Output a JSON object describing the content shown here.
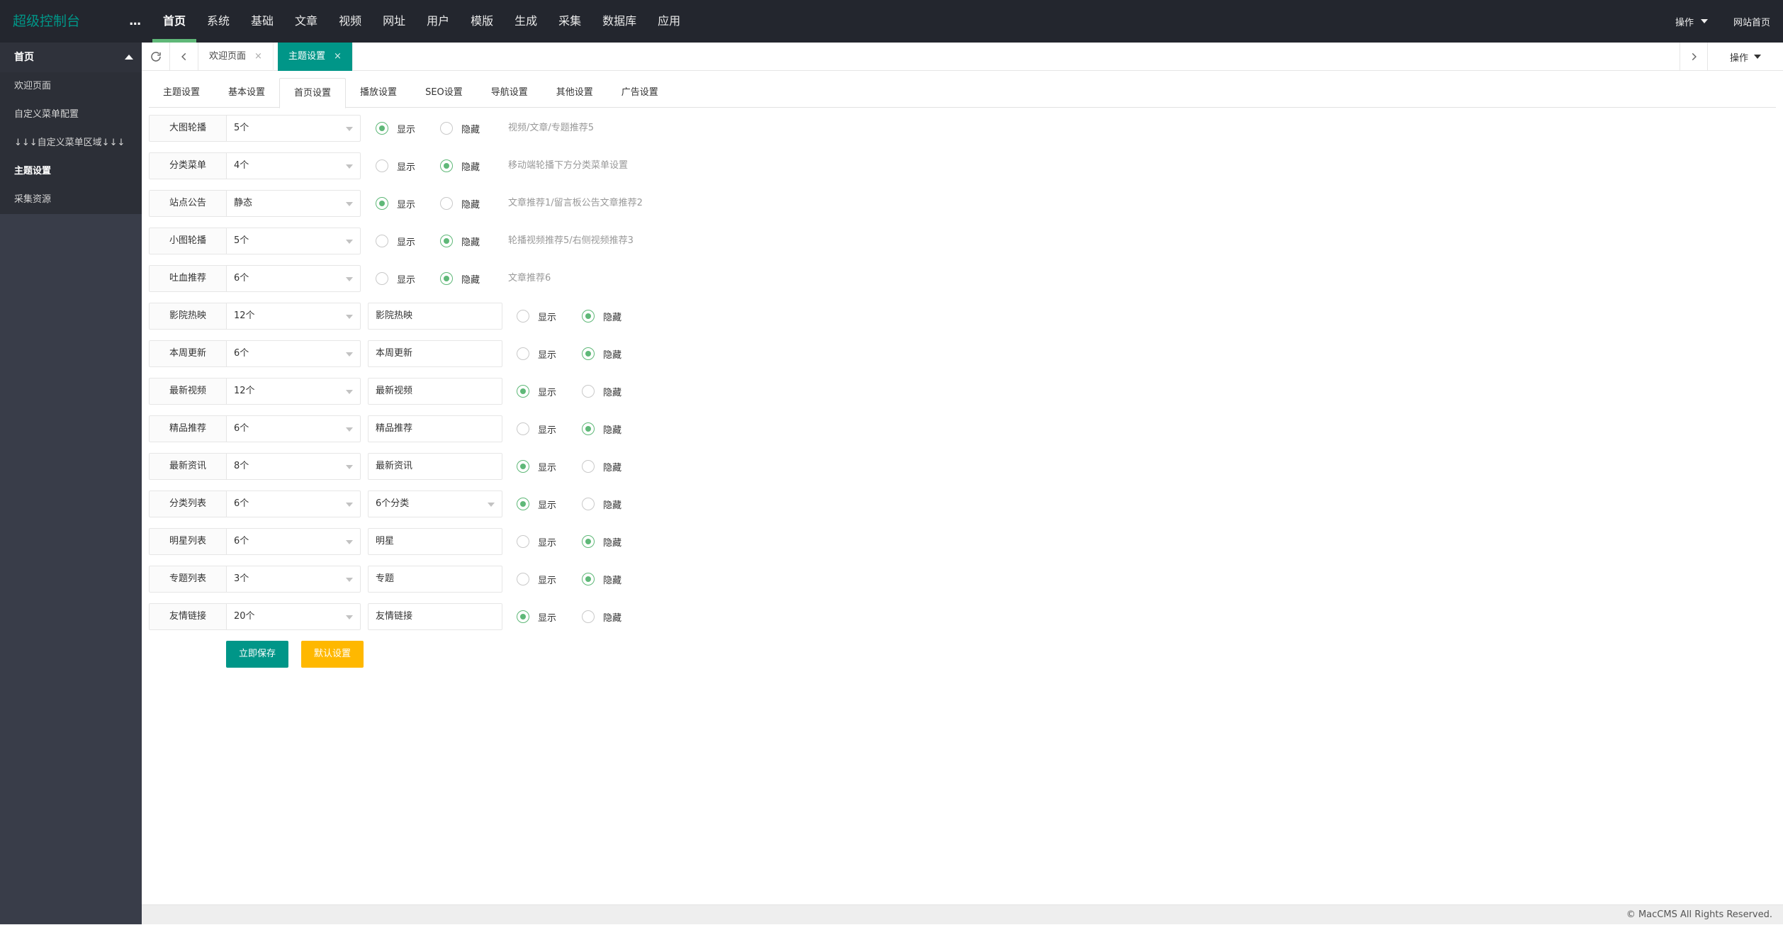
{
  "header": {
    "brand": "超级控制台",
    "more": "...",
    "nav": [
      "首页",
      "系统",
      "基础",
      "文章",
      "视频",
      "网址",
      "用户",
      "模版",
      "生成",
      "采集",
      "数据库",
      "应用"
    ],
    "active_index": 0,
    "ops_label": "操作",
    "site_home": "网站首页"
  },
  "sidebar": {
    "head": "首页",
    "items": [
      "欢迎页面",
      "自定义菜单配置",
      "↓↓↓自定义菜单区域↓↓↓",
      "主题设置",
      "采集资源"
    ],
    "active_index": 3
  },
  "tabbar": {
    "tabs": [
      {
        "label": "欢迎页面",
        "close": "×"
      },
      {
        "label": "主题设置",
        "close": "×"
      }
    ],
    "active_index": 1,
    "ops_label": "操作"
  },
  "settings_tabs": [
    "主题设置",
    "基本设置",
    "首页设置",
    "播放设置",
    "SEO设置",
    "导航设置",
    "其他设置",
    "广告设置"
  ],
  "settings_active_index": 2,
  "radio_labels": {
    "show": "显示",
    "hide": "隐藏"
  },
  "rows_a": [
    {
      "label": "大图轮播",
      "select": "5个",
      "selected": "show",
      "hint": "视频/文章/专题推荐5"
    },
    {
      "label": "分类菜单",
      "select": "4个",
      "selected": "hide",
      "hint": "移动端轮播下方分类菜单设置"
    },
    {
      "label": "站点公告",
      "select": "静态",
      "selected": "show",
      "hint": "文章推荐1/留言板公告文章推荐2"
    },
    {
      "label": "小图轮播",
      "select": "5个",
      "selected": "hide",
      "hint": "轮播视频推荐5/右侧视频推荐3"
    },
    {
      "label": "吐血推荐",
      "select": "6个",
      "selected": "hide",
      "hint": "文章推荐6"
    }
  ],
  "rows_b": [
    {
      "label": "影院热映",
      "select": "12个",
      "input": "影院热映",
      "selected": "hide"
    },
    {
      "label": "本周更新",
      "select": "6个",
      "input": "本周更新",
      "selected": "hide"
    },
    {
      "label": "最新视频",
      "select": "12个",
      "input": "最新视频",
      "selected": "show"
    },
    {
      "label": "精品推荐",
      "select": "6个",
      "input": "精品推荐",
      "selected": "hide"
    },
    {
      "label": "最新资讯",
      "select": "8个",
      "input": "最新资讯",
      "selected": "show"
    },
    {
      "label": "分类列表",
      "select": "6个",
      "input": "6个分类",
      "input_is_select": true,
      "selected": "show"
    },
    {
      "label": "明星列表",
      "select": "6个",
      "input": "明星",
      "selected": "hide"
    },
    {
      "label": "专题列表",
      "select": "3个",
      "input": "专题",
      "selected": "hide"
    },
    {
      "label": "友情链接",
      "select": "20个",
      "input": "友情链接",
      "selected": "show"
    }
  ],
  "buttons": {
    "save": "立即保存",
    "default": "默认设置"
  },
  "footer": "© MacCMS All Rights Reserved.",
  "colors": {
    "accent": "#009688",
    "radio_green": "#5fb878",
    "warn": "#ffb800",
    "header_bg": "#23262e",
    "sidebar_bg": "#393d49"
  }
}
